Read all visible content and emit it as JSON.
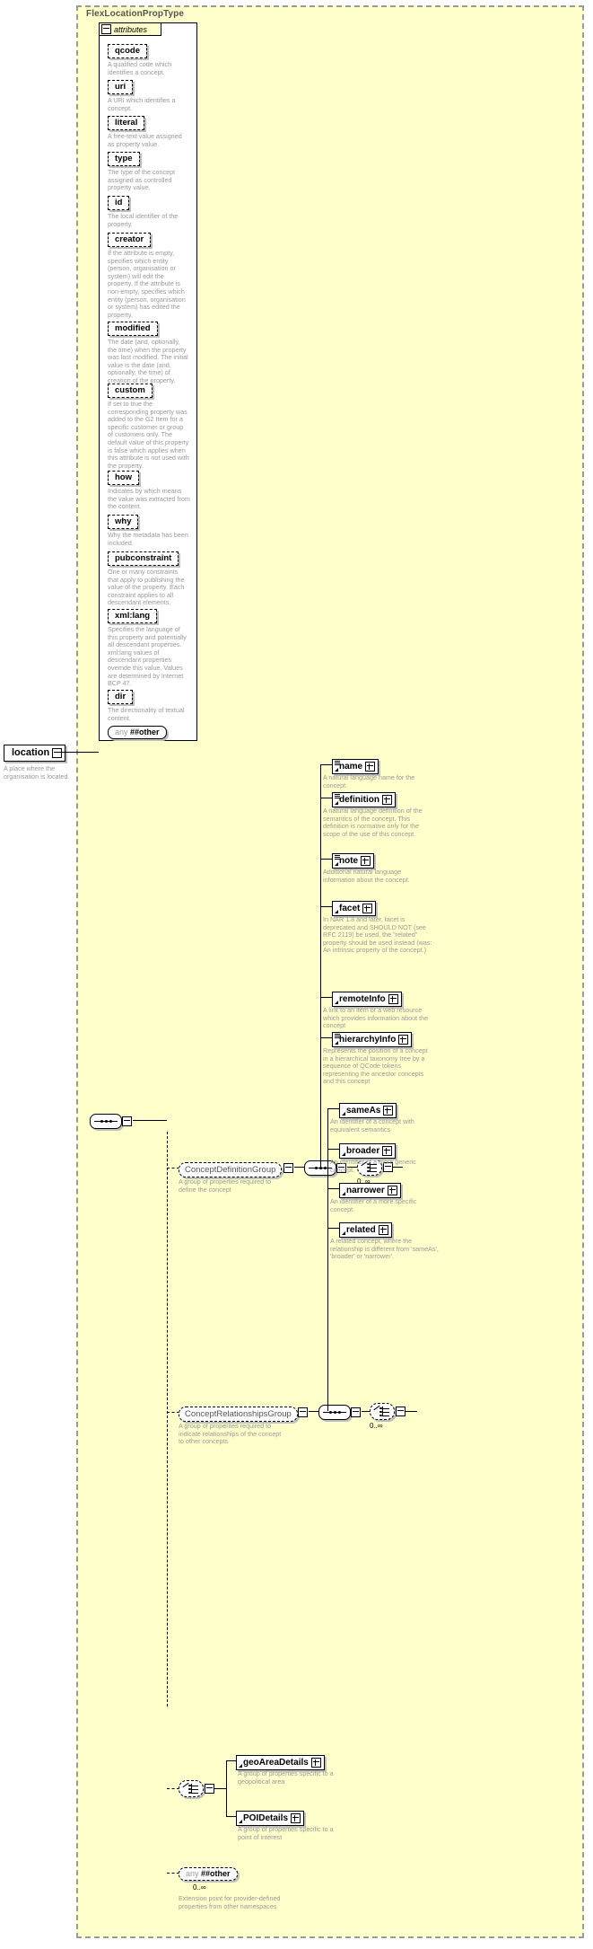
{
  "type": {
    "name": "FlexLocationPropType"
  },
  "attributes_panel": {
    "label": "attributes",
    "items": [
      {
        "name": "qcode",
        "doc": "A qualified code which identifies a concept."
      },
      {
        "name": "uri",
        "doc": "A URI which identifies a concept."
      },
      {
        "name": "literal",
        "doc": "A free-text value assigned as property value."
      },
      {
        "name": "type",
        "doc": "The type of the concept assigned as controlled property value."
      },
      {
        "name": "id",
        "doc": "The local identifier of the property."
      },
      {
        "name": "creator",
        "doc": "If the attribute is empty, specifies which entity (person, organisation or system) will edit the property. If the attribute is non-empty, specifies which entity (person, organisation or system) has edited the property."
      },
      {
        "name": "modified",
        "doc": "The date (and, optionally, the time) when the property was last modified. The initial value is the date (and, optionally, the time) of creation of the property."
      },
      {
        "name": "custom",
        "doc": "If set to true the corresponding property was added to the G2 Item for a specific customer or group of customers only. The default value of this property is false which applies when this attribute is not used with the property."
      },
      {
        "name": "how",
        "doc": "Indicates by which means the value was extracted from the content."
      },
      {
        "name": "why",
        "doc": "Why the metadata has been included."
      },
      {
        "name": "pubconstraint",
        "doc": "One or many constraints that apply to publishing the value of the property. Each constraint applies to all descendant elements."
      },
      {
        "name": "xml:lang",
        "doc": "Specifies the language of this property and potentially all descendant properties. xml:lang values of descendant properties override this value. Values are determined by Internet BCP 47."
      },
      {
        "name": "dir",
        "doc": "The directionality of textual content."
      }
    ],
    "any_other": {
      "prefix": "any",
      "name": "##other"
    }
  },
  "root": {
    "name": "location",
    "doc": "A place where the organisation is located."
  },
  "concept_definition_group": {
    "name": "ConceptDefinitionGroup",
    "doc": "A group of properties required to define the concept",
    "cardinality": "0..∞",
    "children": [
      {
        "name": "name",
        "doc": "A natural language name for the concept."
      },
      {
        "name": "definition",
        "doc": "A natural language definition of the semantics of the concept. This definition is normative only for the scope of the use of this concept."
      },
      {
        "name": "note",
        "doc": "Additional natural language information about the concept."
      },
      {
        "name": "facet",
        "doc": "In NAR 1.8 and later, facet is deprecated and SHOULD NOT (see RFC 2119) be used, the \"related\" property should be used instead (was: An intrinsic property of the concept.)"
      },
      {
        "name": "remoteInfo",
        "doc": "A link to an item or a web resource which provides information about the concept"
      },
      {
        "name": "hierarchyInfo",
        "doc": "Represents the position of a concept in a hierarchical taxonomy tree by a sequence of QCode tokens representing the ancestor concepts and this concept"
      }
    ]
  },
  "concept_relationships_group": {
    "name": "ConceptRelationshipsGroup",
    "doc": "A group of properites required to indicate relationships of the concept to other concepts",
    "cardinality": "0..∞",
    "children": [
      {
        "name": "sameAs",
        "doc": "An identifier of a concept with equivalent semantics"
      },
      {
        "name": "broader",
        "doc": "An identifier of a more generic concept."
      },
      {
        "name": "narrower",
        "doc": "An identifier of a more specific concept."
      },
      {
        "name": "related",
        "doc": "A related concept, where the relationship is different from 'sameAs', 'broader' or 'narrower'."
      }
    ]
  },
  "details_choice": {
    "children": [
      {
        "name": "geoAreaDetails",
        "doc": "A group of properties specific to a geopolitical area"
      },
      {
        "name": "POIDetails",
        "doc": "A group of properties specific to a point of interest"
      }
    ]
  },
  "extension": {
    "prefix": "any",
    "name": "##other",
    "cardinality": "0..∞",
    "doc": "Extension point for provider-defined properties from other namespaces"
  },
  "colors": {
    "panel_background": "#ffffcc",
    "doc_text": "#9a9a9a",
    "border": "#000000",
    "shadow": "#bfbfbf"
  }
}
